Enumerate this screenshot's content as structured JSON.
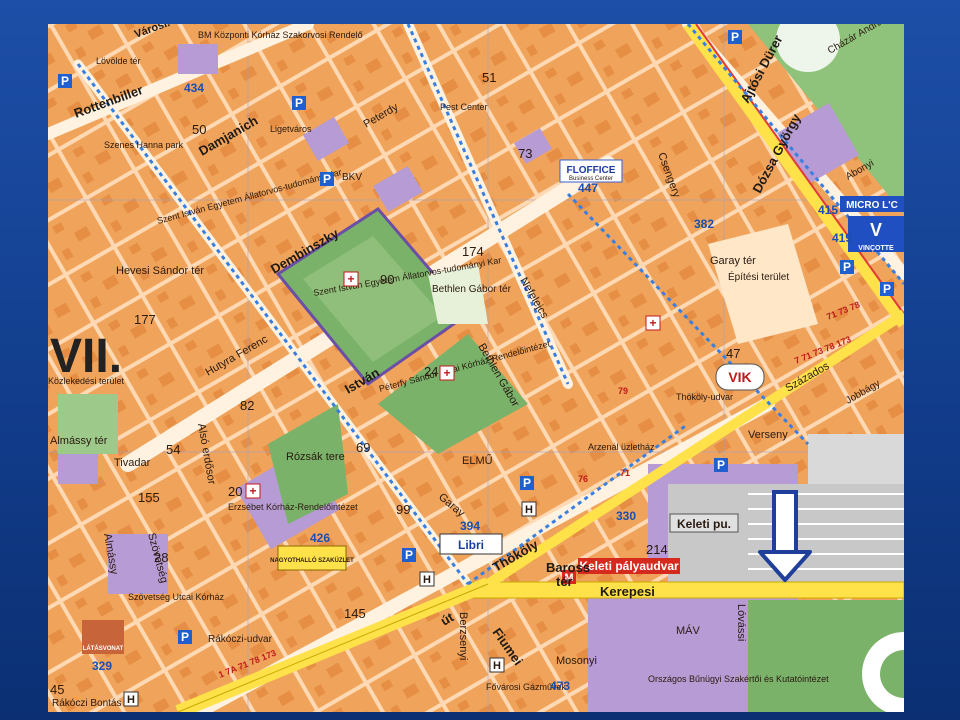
{
  "district": "VII.",
  "colors": {
    "slide_bg": "#1d4fa8",
    "block": "#f0a35a",
    "street": "#ffd9b3",
    "park": "#7ab26a",
    "institution": "#b79bd4",
    "rail": "#ffe24a",
    "arrow": "#1f3f9a"
  },
  "streets": {
    "damjanich": "Damjanich",
    "dembinszky": "Dembinszky",
    "istvan": "István",
    "thokoly": "Thököly",
    "kerepesi": "Kerepesi",
    "ut": "út",
    "dozsa": "Dózsa György",
    "ajtosi": "Ajtósi Dürer",
    "bethlen": "Bethlen Gábor",
    "rottenbiller": "Rottenbiller",
    "rozsak": "Rózsák",
    "tivadar": "Tivadar",
    "almassy": "Almássy",
    "fiumei": "Fiumei",
    "mosonyi": "Mosonyi",
    "verseny": "Verseny",
    "szazados": "Százados",
    "garay": "Garay",
    "lovassi": "Lóvássi",
    "berzsenyi": "Berzsenyi",
    "szovetseg": "Szövetség",
    "baross": "Baross",
    "baross_ter": "tér",
    "alsoerdosor": "Alsó erdősor",
    "hutyra": "Hutyra Ferenc",
    "petenyi": "Peterdy",
    "nefelejcs": "Nefelejcs",
    "csengery": "Csengery"
  },
  "places": {
    "szent_istvan": "Szent István Egyetem Állatorvos-tudományi Kar",
    "szent_istvan_top": "Szent István Egyetem Állatorvos-tudományi Kar",
    "bethlen_ter": "Bethlen Gábor tér",
    "peterfy": "Péterfy Sándor Utcai Kórház Rendelőintézet",
    "rozsak_tere": "Rózsák tere",
    "almassy_ter": "Almássy tér",
    "hevesi_ter": "Hevesi Sándor tér",
    "keleti_pu": "Keleti pu.",
    "keleti_palyaudvar": "Keleti pályaudvar",
    "baross_ter_lbl": "Baross tér",
    "garay_ter": "Garay tér",
    "epitesi_terulet": "Építési terület",
    "erzsebet": "Erzsébet Kórház-Rendelőintézet",
    "szovetseg_korhaz": "Szövetség Utcai Kórház",
    "fovarosi": "Fővárosi Gázművek",
    "orszagos": "Országos Bűnügyi Szakértői és Kutatóintézet",
    "rakoczi": "Rákóczi-udvar",
    "rakoczi_bontas": "Rákóczi Bontás",
    "thokoly_udvar": "Thököly-udvar",
    "arzenal": "Arzenál üzletház",
    "pest_center": "Pest Center",
    "bkv": "BKV",
    "lovolde_ter": "Lövölde tér",
    "bm_kozponti": "BM Központi Kórház Szakorvosi Rendelő",
    "ligetvaros": "Ligetváros",
    "szenes_hanna": "Szenes Hanna park",
    "mav": "MÁV",
    "elmu": "ELMŰ",
    "varosliget": "Városl.",
    "chazar": "Cházár András",
    "abony": "Abonyi",
    "joborgy": "Jobbágy",
    "kozlesi": "Közlekedési terület"
  },
  "brands": {
    "floffice": "FLOFFICE",
    "floffice_sub": "Business Center",
    "vik": "VIK",
    "libri": "Libri",
    "vincotte": "VINÇOTTE",
    "micro": "MICRO L'C",
    "nagyothallo": "NAGYOTHALLÓ SZAKÜZLET",
    "lakasvonat": "LÁTÁSVONAT"
  },
  "numbers": {
    "n434": "434",
    "n50": "50",
    "n51": "51",
    "n73": "73",
    "n174": "174",
    "n90": "90",
    "n177": "177",
    "n24": "24",
    "n82": "82",
    "n54": "54",
    "n69": "69",
    "n155": "155",
    "n20": "20",
    "n99": "99",
    "n426": "426",
    "n394": "394",
    "n214": "214",
    "n330": "330",
    "n447": "447",
    "n382": "382",
    "n415": "415",
    "n419": "419",
    "n47": "47",
    "n145": "145",
    "n329": "329",
    "n473": "473",
    "n45": "45",
    "n28": "28",
    "n71": "71",
    "n76": "76",
    "n79": "79"
  },
  "tram_numbers": {
    "t1": "1 7A 71 78 173",
    "t2": "7 71 73 78 173",
    "t3": "71 73 78"
  },
  "symbols": {
    "parking": "P",
    "hospital": "H",
    "metro": "M",
    "cross": "+"
  }
}
